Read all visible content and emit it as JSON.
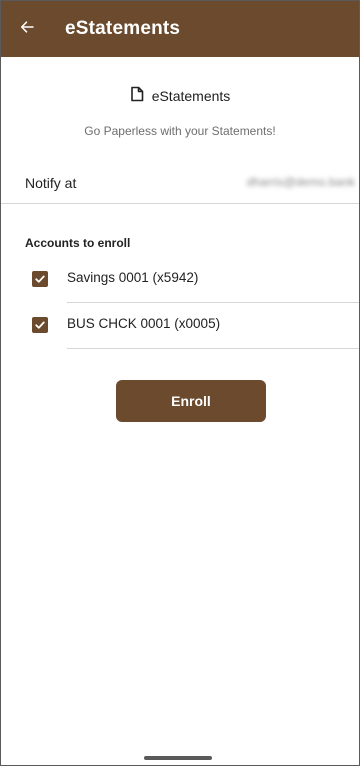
{
  "app_bar": {
    "title": "eStatements",
    "back_icon": "arrow-left-icon",
    "background_color": "#6b4a2e"
  },
  "header": {
    "icon": "document-icon",
    "title": "eStatements",
    "subtitle": "Go Paperless with your Statements!"
  },
  "notify": {
    "label": "Notify at",
    "value": "dharris@demo.bank"
  },
  "accounts": {
    "section_label": "Accounts to enroll",
    "items": [
      {
        "label": "Savings 0001 (x5942)",
        "checked": true
      },
      {
        "label": "BUS CHCK 0001 (x0005)",
        "checked": true
      }
    ]
  },
  "actions": {
    "enroll_label": "Enroll"
  },
  "theme": {
    "accent": "#6b4a2e"
  }
}
